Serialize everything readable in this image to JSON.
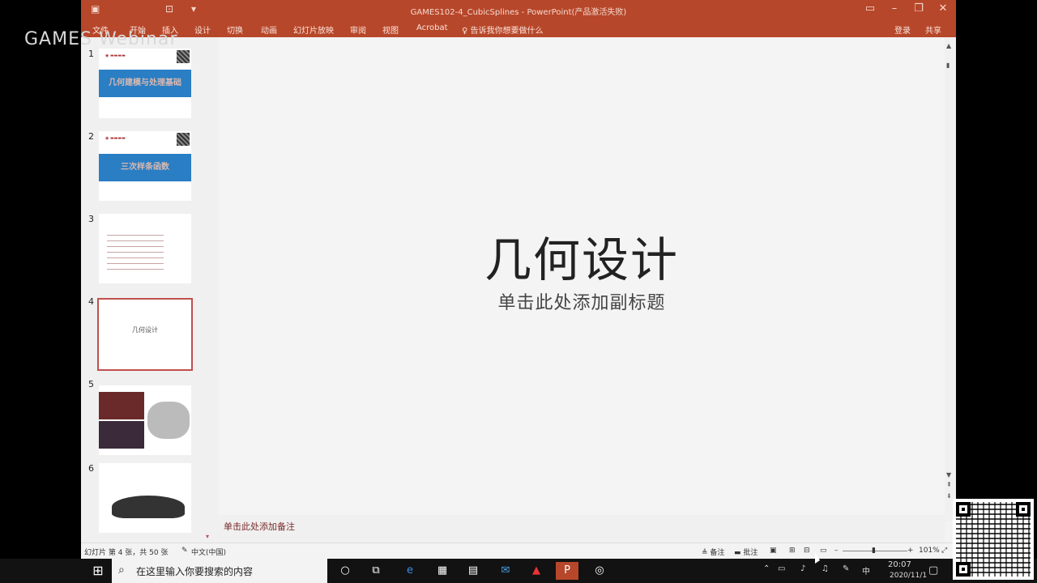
{
  "watermark": "GAMES Webinar",
  "window": {
    "title": "GAMES102-4_CubicSplines - PowerPoint(产品激活失败)",
    "minimize_icon": "minimize-icon",
    "restore_icon": "restore-icon",
    "close_icon": "close-icon"
  },
  "ribbon": {
    "tabs": [
      "文件",
      "开始",
      "插入",
      "设计",
      "切换",
      "动画",
      "幻灯片放映",
      "审阅",
      "视图",
      "Acrobat"
    ],
    "tell_me": "♀ 告诉我你想要做什么",
    "signin": "登录",
    "share": "共享"
  },
  "thumbnails": [
    {
      "num": "1",
      "band_text": "几何建模与处理基础"
    },
    {
      "num": "2",
      "band_text": "三次样条函数"
    },
    {
      "num": "3",
      "band_text": ""
    },
    {
      "num": "4",
      "band_text": "几何设计"
    },
    {
      "num": "5",
      "band_text": ""
    },
    {
      "num": "6",
      "band_text": ""
    }
  ],
  "slide": {
    "title": "几何设计",
    "subtitle": "单击此处添加副标题"
  },
  "notes": {
    "placeholder": "单击此处添加备注"
  },
  "status": {
    "slide_counter": "幻灯片 第 4 张，共 50 张",
    "language": "中文(中国)",
    "notes_btn": "备注",
    "comments_btn": "批注",
    "zoom": "101%"
  },
  "taskbar": {
    "search_placeholder": "在这里输入你要搜索的内容",
    "ime": "中",
    "time": "20:07",
    "date": "2020/11/1"
  },
  "colors": {
    "accent": "#b7472a",
    "slide_bg": "#f4f4f4",
    "taskbar": "#121212"
  }
}
